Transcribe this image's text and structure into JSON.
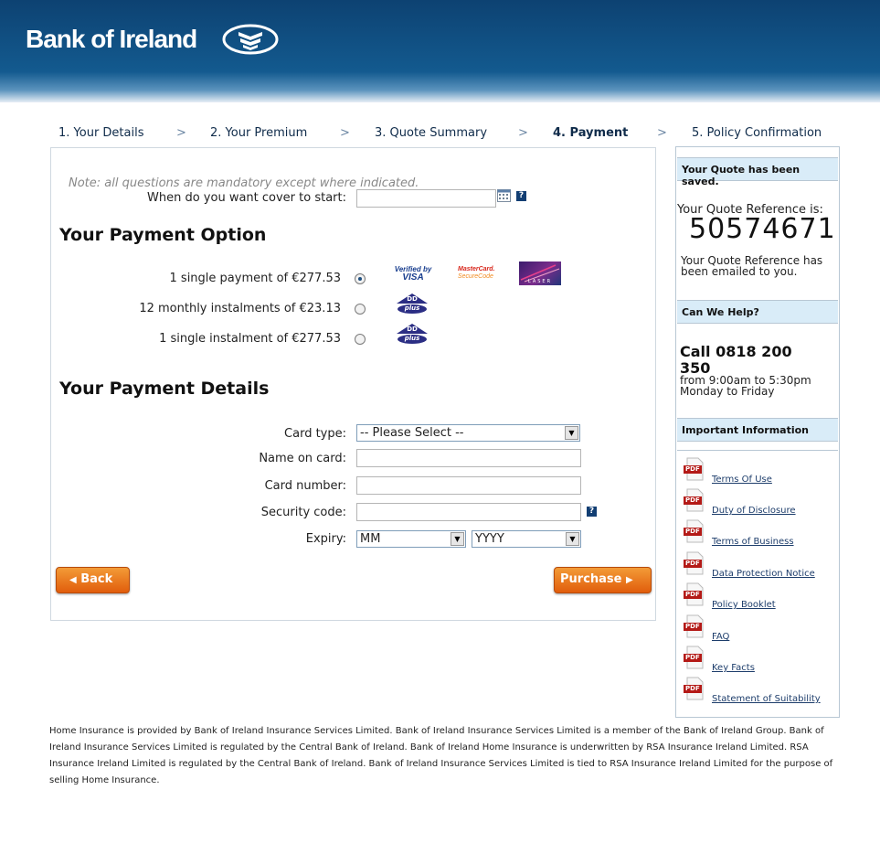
{
  "brand": {
    "name": "Bank of Ireland"
  },
  "steps": [
    {
      "label": "1. Your Details"
    },
    {
      "label": "2. Your Premium"
    },
    {
      "label": "3. Quote Summary"
    },
    {
      "label": "4. Payment",
      "active": true
    },
    {
      "label": "5. Policy Confirmation"
    }
  ],
  "step_separator": ">",
  "form": {
    "note": "Note: all questions are mandatory except where indicated.",
    "cover_start_label": "When do you want cover to start:",
    "cover_start_value": "",
    "help_glyph": "?",
    "payment_option_heading": "Your Payment Option",
    "options": [
      {
        "label": "1 single payment of €277.53",
        "selected": true,
        "logos": [
          "Verified by VISA",
          "MasterCard SecureCode",
          "LASER"
        ]
      },
      {
        "label": "12 monthly instalments of €23.13",
        "selected": false,
        "logos": [
          "DD plus"
        ]
      },
      {
        "label": "1 single instalment of €277.53",
        "selected": false,
        "logos": [
          "DD plus"
        ]
      }
    ],
    "logo_text": {
      "verified_top": "Verified by",
      "verified_bottom": "VISA",
      "mc_top": "MasterCard.",
      "mc_bottom": "SecureCode",
      "laser": "LASER",
      "dd": "DD",
      "plus": "plus"
    },
    "payment_details_heading": "Your Payment Details",
    "card_type_label": "Card type:",
    "card_type_value": "-- Please Select --",
    "name_label": "Name on card:",
    "name_value": "",
    "number_label": "Card number:",
    "number_value": "",
    "security_label": "Security code:",
    "security_value": "",
    "expiry_label": "Expiry:",
    "expiry_month": "MM",
    "expiry_year": "YYYY",
    "back_button": "Back",
    "purchase_button": "Purchase"
  },
  "sidebar": {
    "saved_heading": "Your Quote has been saved.",
    "ref_label": "Your Quote Reference is:",
    "ref_number": "50574671",
    "emailed_text": "Your Quote Reference has been emailed to you.",
    "help_heading": "Can We Help?",
    "phone_line1": "Call 0818 200",
    "phone_line2": "350",
    "hours_line1": "from 9:00am to 5:30pm",
    "hours_line2": "Monday to Friday",
    "info_heading": "Important Information",
    "pdf_label": "PDF",
    "documents": [
      {
        "label": "Terms Of Use"
      },
      {
        "label": "Duty of Disclosure"
      },
      {
        "label": "Terms of Business"
      },
      {
        "label": "Data Protection Notice"
      },
      {
        "label": "Policy Booklet"
      },
      {
        "label": "FAQ"
      },
      {
        "label": "Key Facts"
      },
      {
        "label": "Statement of Suitability"
      }
    ]
  },
  "footer": {
    "text": "Home Insurance is provided by Bank of Ireland Insurance Services Limited. Bank of Ireland Insurance Services Limited is a member of the Bank of Ireland Group. Bank of Ireland Insurance Services Limited is regulated by the Central Bank of Ireland. Bank of Ireland Home Insurance is underwritten by RSA Insurance Ireland Limited. RSA Insurance Ireland Limited is regulated by the Central Bank of Ireland. Bank of Ireland Insurance Services Limited is tied to RSA Insurance Ireland Limited for the purpose of selling Home Insurance."
  },
  "colors": {
    "brand_blue": "#0d4272",
    "button_orange": "#e8700f",
    "sidebar_header": "#d9ecf8"
  }
}
